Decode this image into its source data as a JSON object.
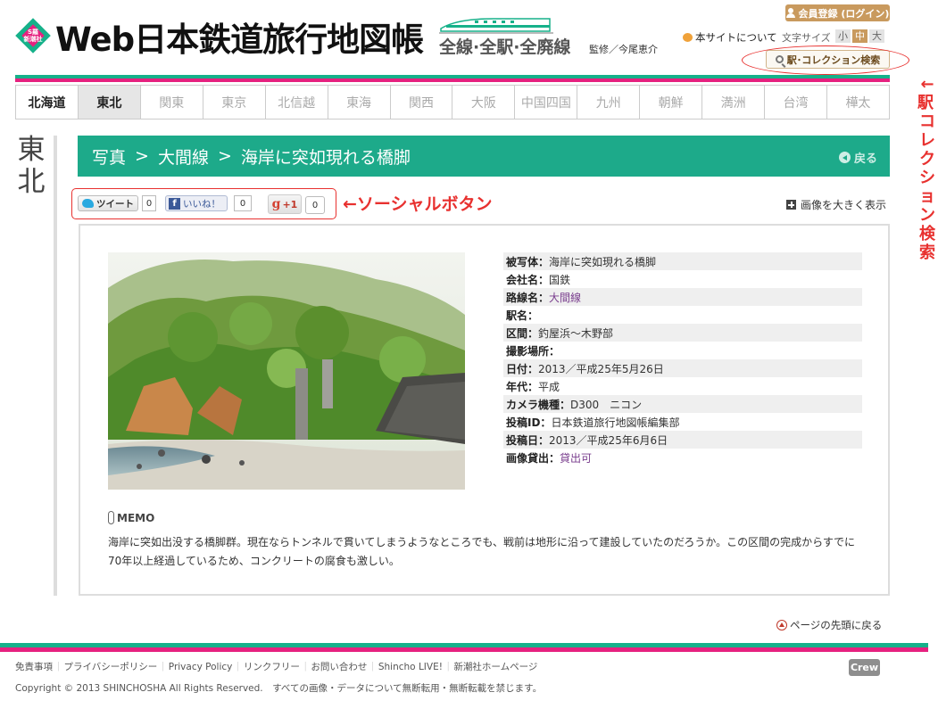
{
  "header": {
    "logo_badge_text": "S羅\n新潮社",
    "site_title": "Web日本鉄道旅行地図帳",
    "site_subtitle": "全線·全駅·全廃線",
    "supervisor": "監修／今尾恵介",
    "member_button": "会員登録 (ログイン)",
    "about_link": "本サイトについて",
    "font_size_label": "文字サイズ",
    "font_sizes": [
      "小",
      "中",
      "大"
    ],
    "station_search": "駅･コレクション検索"
  },
  "annotations": {
    "search_annotation": "←駅・コレクション検索",
    "social_annotation": "←ソーシャルボタン"
  },
  "regions": [
    "北海道",
    "東北",
    "関東",
    "東京",
    "北信越",
    "東海",
    "関西",
    "大阪",
    "中国四国",
    "九州",
    "朝鮮",
    "満洲",
    "台湾",
    "樺太"
  ],
  "active_region": "東北",
  "side_label": "東北",
  "breadcrumb": {
    "items": [
      "写真",
      "大間線",
      "海岸に突如現れる橋脚"
    ],
    "separator": ">",
    "back_label": "戻る"
  },
  "social": {
    "tweet_label": "ツイート",
    "tweet_count": "0",
    "like_label": "いいね！",
    "like_count": "0",
    "gplus_label": "+1",
    "gplus_count": "0"
  },
  "enlarge_label": "画像を大きく表示",
  "info": [
    {
      "key": "被写体：",
      "value": "海岸に突如現れる橋脚"
    },
    {
      "key": "会社名：",
      "value": "国鉄"
    },
    {
      "key": "路線名：",
      "value": "大間線",
      "link": true
    },
    {
      "key": "駅名：",
      "value": ""
    },
    {
      "key": "区間：",
      "value": "釣屋浜〜木野部"
    },
    {
      "key": "撮影場所：",
      "value": ""
    },
    {
      "key": "日付：",
      "value": "2013／平成25年5月26日"
    },
    {
      "key": "年代：",
      "value": "平成"
    },
    {
      "key": "カメラ機種：",
      "value": "D300　ニコン"
    },
    {
      "key": "投稿ID：",
      "value": "日本鉄道旅行地図帳編集部"
    },
    {
      "key": "投稿日：",
      "value": "2013／平成25年6月6日"
    },
    {
      "key": "画像貸出：",
      "value": "貸出可",
      "link": true
    }
  ],
  "memo": {
    "label": "MEMO",
    "text": "海岸に突如出没する橋脚群。現在ならトンネルで貫いてしまうようなところでも、戦前は地形に沿って建設していたのだろうか。この区間の完成からすでに70年以上経過しているため、コンクリートの腐食も激しい。"
  },
  "pagetop_label": "ページの先頭に戻る",
  "footer": {
    "links": [
      "免責事項",
      "プライバシーポリシー",
      "Privacy Policy",
      "リンクフリー",
      "お問い合わせ",
      "Shincho LIVE!",
      "新潮社ホームページ"
    ],
    "crew_badge": "Crew",
    "copyright": "Copyright © 2013 SHINCHOSHA All Rights Reserved.　すべての画像・データについて無断転用・無断転載を禁じます。"
  },
  "colors": {
    "brand_green": "#16b18a",
    "brand_pink": "#e6217f",
    "breadcrumb_bg": "#1daa8a",
    "annotation_red": "#e8312f",
    "member_gold": "#c99a5e"
  }
}
